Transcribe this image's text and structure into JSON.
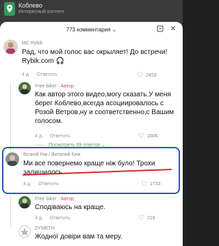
{
  "banner": {
    "title": "Коблево",
    "subtitle": "Интересный контент"
  },
  "sheet": {
    "count_label": "773 комментария",
    "dropdown_glyph": "⌄",
    "icon_emoji": "@",
    "icon_close": "✕"
  },
  "comments": [
    {
      "author": "MC Rybik",
      "text": "Рад, что мой голос вас окрыляет! До встречи! Rybik.com 🎧",
      "time": "4 д.",
      "reply": "Ответить",
      "likes": "2453"
    },
    {
      "author": "Free biker",
      "badge": "· Автор",
      "text": "Как автор этого видео,могу сказать.У меня берег Коблево,всегда асоциировалось с Розой Ветров,ну и соответственно,с Вашим голосом.",
      "time": "4 д.",
      "reply": "Ответить",
      "likes": "1606"
    },
    {
      "more": "Посмотреть 69 ответов ⌄"
    },
    {
      "author": "Віталій Кім / Виталий Ким",
      "text": "Ми все повернемо краще ніж було! Трохи залишилось",
      "time": "4 д.",
      "reply": "Ответить",
      "likes": "1733"
    },
    {
      "author": "Free biker",
      "badge": "· Автор",
      "text": "Сподіваюсь на краще.",
      "time": "4 д.",
      "reply": "Ответить",
      "likes": "219"
    },
    {
      "author": "ZYMETH",
      "text": "Жодної довіри вам та меру.",
      "likes": ""
    }
  ],
  "colors": {
    "highlight_border": "#1f55c8",
    "annotation_underline": "#d9282b",
    "author_badge": "#e0405a"
  }
}
